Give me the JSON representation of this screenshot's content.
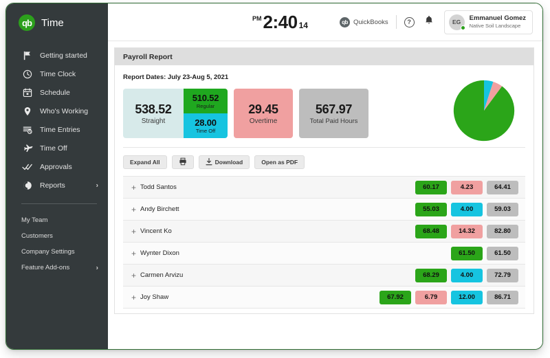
{
  "brand": {
    "logo_text": "qb",
    "name": "Time"
  },
  "sidebar": {
    "items": [
      {
        "label": "Getting started",
        "icon": "flag-icon",
        "chevron": ""
      },
      {
        "label": "Time Clock",
        "icon": "clock-icon",
        "chevron": ""
      },
      {
        "label": "Schedule",
        "icon": "calendar-icon",
        "chevron": ""
      },
      {
        "label": "Who's Working",
        "icon": "map-pin-icon",
        "chevron": ""
      },
      {
        "label": "Time Entries",
        "icon": "time-entries-icon",
        "chevron": ""
      },
      {
        "label": "Time Off",
        "icon": "airplane-icon",
        "chevron": ""
      },
      {
        "label": "Approvals",
        "icon": "double-check-icon",
        "chevron": ""
      },
      {
        "label": "Reports",
        "icon": "pie-chart-icon",
        "chevron": "›"
      }
    ],
    "sub_items": [
      {
        "label": "My Team",
        "chevron": ""
      },
      {
        "label": "Customers",
        "chevron": ""
      },
      {
        "label": "Company Settings",
        "chevron": ""
      },
      {
        "label": "Feature Add-ons",
        "chevron": "›"
      }
    ]
  },
  "topbar": {
    "clock": {
      "ampm": "PM",
      "time": "2:40",
      "seconds": "14"
    },
    "quickbooks": {
      "mark": "qb",
      "label": "QuickBooks"
    },
    "help_icon_label": "?",
    "bell_icon_label": "notifications-bell",
    "user": {
      "initials": "EG",
      "name": "Emmanuel Gomez",
      "org": "Native Soil Landscape",
      "status": "online"
    }
  },
  "report": {
    "panel_title": "Payroll Report",
    "dates_label": "Report Dates: July 23-Aug 5, 2021",
    "cards": {
      "straight": {
        "value": "538.52",
        "label": "Straight"
      },
      "regular": {
        "value": "510.52",
        "label": "Regular"
      },
      "time_off": {
        "value": "28.00",
        "label": "Time Off"
      },
      "overtime": {
        "value": "29.45",
        "label": "Overtime"
      },
      "total": {
        "value": "567.97",
        "label": "Total Paid Hours"
      }
    },
    "toolbar": [
      {
        "label": "Expand All",
        "icon": ""
      },
      {
        "label": "",
        "icon": "printer-icon"
      },
      {
        "label": "Download",
        "icon": "download-icon"
      },
      {
        "label": "Open as PDF",
        "icon": ""
      }
    ],
    "rows": [
      {
        "name": "Todd Santos",
        "cells": [
          {
            "v": "",
            "c": "v-empty"
          },
          {
            "v": "60.17",
            "c": "v-green"
          },
          {
            "v": "4.23",
            "c": "v-pink"
          },
          {
            "v": "64.41",
            "c": "v-gray"
          }
        ]
      },
      {
        "name": "Andy Birchett",
        "cells": [
          {
            "v": "",
            "c": "v-empty"
          },
          {
            "v": "55.03",
            "c": "v-green"
          },
          {
            "v": "4.00",
            "c": "v-cyan"
          },
          {
            "v": "59.03",
            "c": "v-gray"
          }
        ]
      },
      {
        "name": "Vincent Ko",
        "cells": [
          {
            "v": "",
            "c": "v-empty"
          },
          {
            "v": "68.48",
            "c": "v-green"
          },
          {
            "v": "14.32",
            "c": "v-pink"
          },
          {
            "v": "82.80",
            "c": "v-gray"
          }
        ]
      },
      {
        "name": "Wynter Dixon",
        "cells": [
          {
            "v": "",
            "c": "v-empty"
          },
          {
            "v": "",
            "c": "v-empty"
          },
          {
            "v": "61.50",
            "c": "v-green"
          },
          {
            "v": "61.50",
            "c": "v-gray"
          }
        ]
      },
      {
        "name": "Carmen Arvizu",
        "cells": [
          {
            "v": "",
            "c": "v-empty"
          },
          {
            "v": "68.29",
            "c": "v-green"
          },
          {
            "v": "4.00",
            "c": "v-cyan"
          },
          {
            "v": "72.79",
            "c": "v-gray"
          }
        ]
      },
      {
        "name": "Joy Shaw",
        "cells": [
          {
            "v": "67.92",
            "c": "v-green"
          },
          {
            "v": "6.79",
            "c": "v-pink"
          },
          {
            "v": "12.00",
            "c": "v-cyan"
          },
          {
            "v": "86.71",
            "c": "v-gray"
          }
        ]
      }
    ],
    "expand_glyph": "+"
  },
  "chart_data": {
    "type": "pie",
    "title": "",
    "labels": [
      "Time Off",
      "Overtime",
      "Regular"
    ],
    "values": [
      28.0,
      29.45,
      510.52
    ],
    "colors": [
      "#16c4e0",
      "#f0a0a0",
      "#2ba519"
    ],
    "legend": "none",
    "start_angle_deg": 0,
    "total": 567.97
  },
  "colors": {
    "brand_green": "#2ca01c",
    "sidebar_bg": "#343a3c",
    "green": "#2ba519",
    "pink": "#f0a0a0",
    "cyan": "#16c4e0",
    "gray": "#bdbdbd",
    "pale_teal": "#d7eaea"
  }
}
